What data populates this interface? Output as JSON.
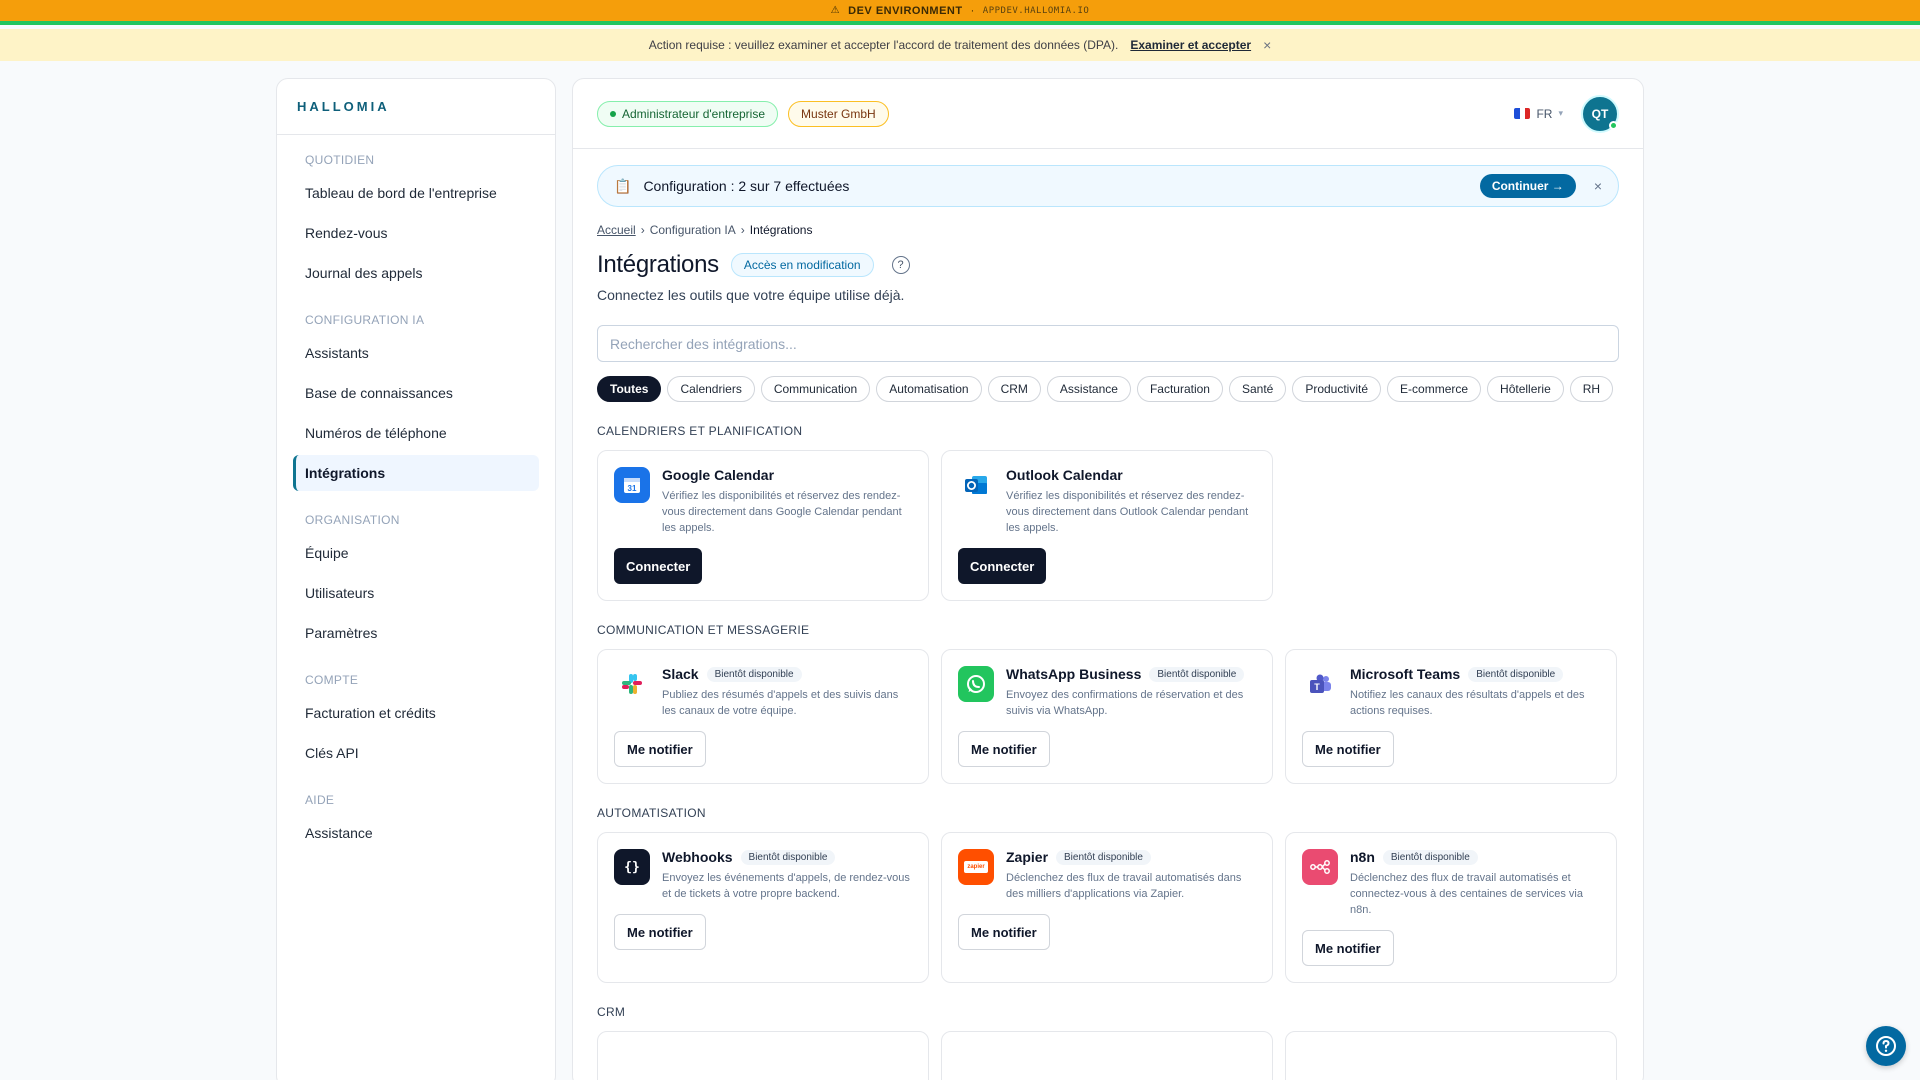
{
  "devbar": {
    "icon": "warning-icon",
    "label": "DEV ENVIRONMENT",
    "sep": "·",
    "host": "APPDEV.HALLOMIA.IO"
  },
  "dpa": {
    "message": "Action requise : veuillez examiner et accepter l'accord de traitement des données (DPA).",
    "link": "Examiner et accepter",
    "close": "×"
  },
  "sidebar": {
    "brand": "HALLOMIA",
    "sections": [
      {
        "heading": "QUOTIDIEN",
        "items": [
          "Tableau de bord de l'entreprise",
          "Rendez-vous",
          "Journal des appels"
        ]
      },
      {
        "heading": "CONFIGURATION IA",
        "items": [
          "Assistants",
          "Base de connaissances",
          "Numéros de téléphone",
          "Intégrations"
        ]
      },
      {
        "heading": "ORGANISATION",
        "items": [
          "Équipe",
          "Utilisateurs",
          "Paramètres"
        ]
      },
      {
        "heading": "COMPTE",
        "items": [
          "Facturation et crédits",
          "Clés API"
        ]
      },
      {
        "heading": "AIDE",
        "items": [
          "Assistance"
        ]
      }
    ],
    "active": "Intégrations"
  },
  "topbar": {
    "role": "Administrateur d'entreprise",
    "company": "Muster GmbH",
    "lang": "FR",
    "avatar": "QT"
  },
  "setup": {
    "text": "Configuration : 2 sur 7 effectuées",
    "continue": "Continuer →",
    "close": "×"
  },
  "breadcrumb": {
    "home": "Accueil",
    "sep": "›",
    "parent": "Configuration IA",
    "current": "Intégrations"
  },
  "page": {
    "title": "Intégrations",
    "access": "Accès en modification",
    "help": "?",
    "subtitle": "Connectez les outils que votre équipe utilise déjà."
  },
  "search": {
    "placeholder": "Rechercher des intégrations..."
  },
  "filters": [
    "Toutes",
    "Calendriers",
    "Communication",
    "Automatisation",
    "CRM",
    "Assistance",
    "Facturation",
    "Santé",
    "Productivité",
    "E-commerce",
    "Hôtellerie",
    "RH"
  ],
  "sections": {
    "calendars": {
      "heading": "CALENDRIERS ET PLANIFICATION",
      "cards": [
        {
          "title": "Google Calendar",
          "desc": "Vérifiez les disponibilités et réservez des rendez-vous directement dans Google Calendar pendant les appels.",
          "button": "Connecter",
          "icon": "google-calendar-icon"
        },
        {
          "title": "Outlook Calendar",
          "desc": "Vérifiez les disponibilités et réservez des rendez-vous directement dans Outlook Calendar pendant les appels.",
          "button": "Connecter",
          "icon": "outlook-icon"
        }
      ]
    },
    "communication": {
      "heading": "COMMUNICATION ET MESSAGERIE",
      "cards": [
        {
          "title": "Slack",
          "badge": "Bientôt disponible",
          "desc": "Publiez des résumés d'appels et des suivis dans les canaux de votre équipe.",
          "button": "Me notifier",
          "icon": "slack-icon"
        },
        {
          "title": "WhatsApp Business",
          "badge": "Bientôt disponible",
          "desc": "Envoyez des confirmations de réservation et des suivis via WhatsApp.",
          "button": "Me notifier",
          "icon": "whatsapp-icon"
        },
        {
          "title": "Microsoft Teams",
          "badge": "Bientôt disponible",
          "desc": "Notifiez les canaux des résultats d'appels et des actions requises.",
          "button": "Me notifier",
          "icon": "teams-icon"
        }
      ]
    },
    "automation": {
      "heading": "AUTOMATISATION",
      "cards": [
        {
          "title": "Webhooks",
          "badge": "Bientôt disponible",
          "desc": "Envoyez les événements d'appels, de rendez-vous et de tickets à votre propre backend.",
          "button": "Me notifier",
          "icon": "webhooks-icon",
          "glyph": "{}"
        },
        {
          "title": "Zapier",
          "badge": "Bientôt disponible",
          "desc": "Déclenchez des flux de travail automatisés dans des milliers d'applications via Zapier.",
          "button": "Me notifier",
          "icon": "zapier-icon",
          "glyph": "zapier"
        },
        {
          "title": "n8n",
          "badge": "Bientôt disponible",
          "desc": "Déclenchez des flux de travail automatisés et connectez-vous à des centaines de services via n8n.",
          "button": "Me notifier",
          "icon": "n8n-icon"
        }
      ]
    },
    "crm": {
      "heading": "CRM"
    }
  },
  "colors": {
    "primary": "#0369a1",
    "dark": "#0f172a",
    "devbar": "#f59e0b",
    "dpa": "#fef3c7",
    "accent_brand": "#0e5f7a"
  }
}
